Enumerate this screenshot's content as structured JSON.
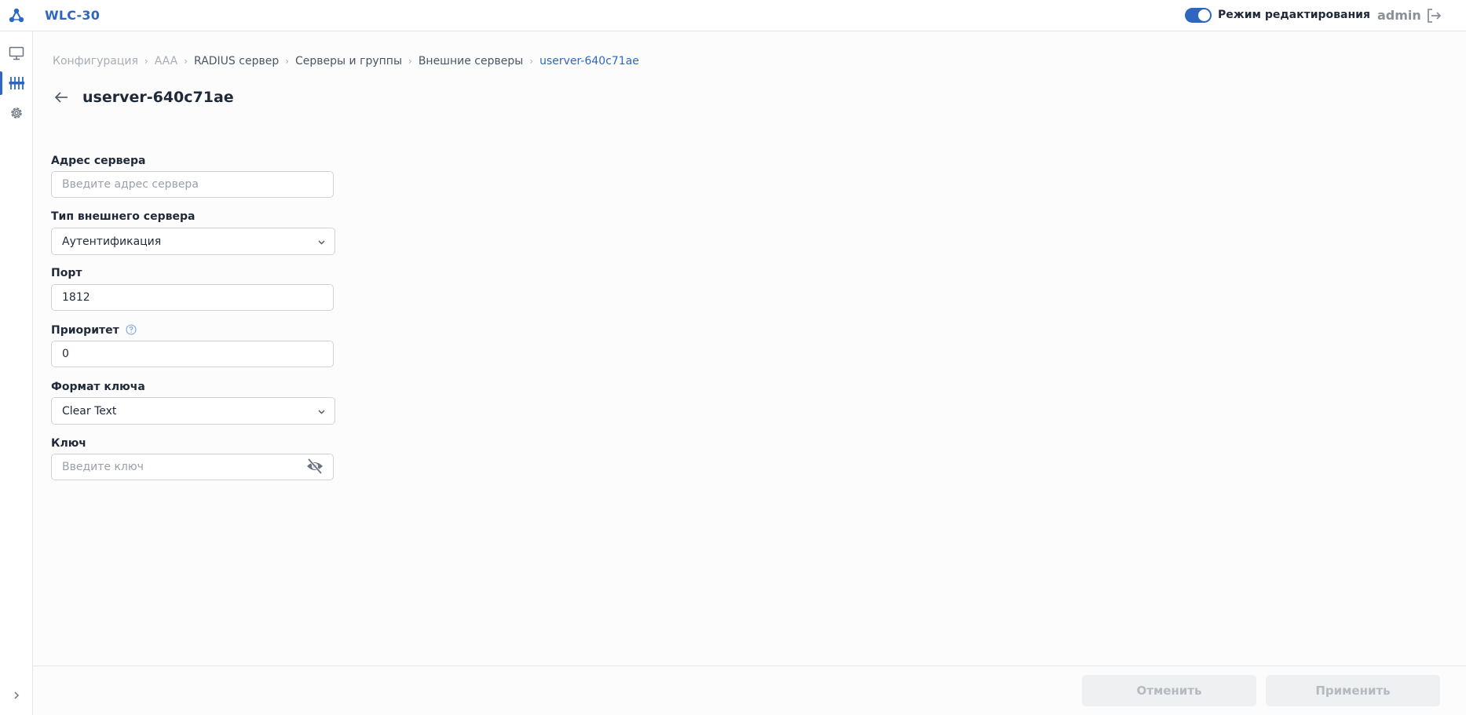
{
  "header": {
    "app_title": "WLC-30",
    "edit_mode_label": "Режим редактирования",
    "edit_mode_on": true,
    "user": "admin"
  },
  "breadcrumb": [
    "Конфигурация",
    "AAA",
    "RADIUS сервер",
    "Серверы и группы",
    "Внешние серверы",
    "userver-640c71ae"
  ],
  "page": {
    "title": "userver-640c71ae"
  },
  "form": {
    "server_address": {
      "label": "Адрес сервера",
      "value": "",
      "placeholder": "Введите адрес сервера"
    },
    "server_type": {
      "label": "Тип внешнего сервера",
      "value": "Аутентификация"
    },
    "port": {
      "label": "Порт",
      "value": "1812"
    },
    "priority": {
      "label": "Приоритет",
      "value": "0"
    },
    "key_format": {
      "label": "Формат ключа",
      "value": "Clear Text"
    },
    "key": {
      "label": "Ключ",
      "value": "",
      "placeholder": "Введите ключ"
    }
  },
  "footer": {
    "cancel_label": "Отменить",
    "apply_label": "Применить"
  },
  "colors": {
    "accent": "#2f66c2",
    "disabled_button_bg": "#eef0f2",
    "disabled_button_text": "#b6bac0"
  },
  "icons": {
    "logo": "network-nodes-icon",
    "logout": "logout-icon",
    "sidebar": [
      "monitor-icon",
      "sliders-icon",
      "gear-icon"
    ],
    "expand": "chevron-right-icon",
    "back": "arrow-left-icon",
    "help": "question-circle-icon",
    "select": "chevron-down-icon",
    "password": "eye-off-icon"
  }
}
